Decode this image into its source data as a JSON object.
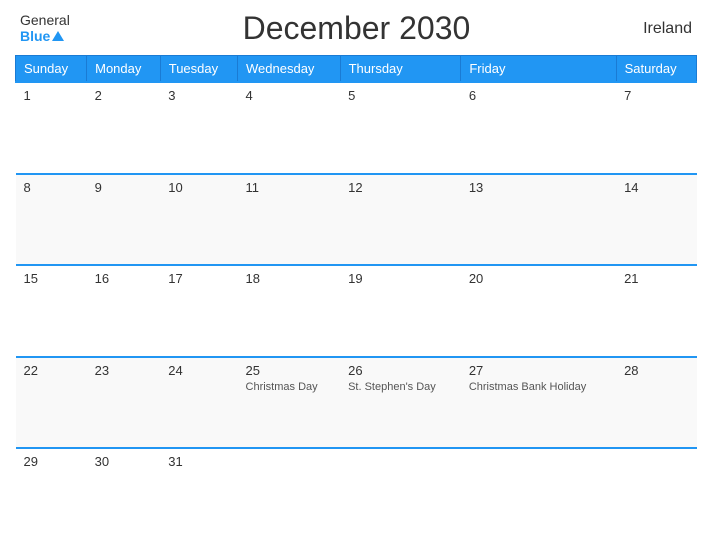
{
  "header": {
    "logo_general": "General",
    "logo_blue": "Blue",
    "title": "December 2030",
    "country": "Ireland"
  },
  "weekdays": [
    "Sunday",
    "Monday",
    "Tuesday",
    "Wednesday",
    "Thursday",
    "Friday",
    "Saturday"
  ],
  "weeks": [
    [
      {
        "day": "1",
        "event": ""
      },
      {
        "day": "2",
        "event": ""
      },
      {
        "day": "3",
        "event": ""
      },
      {
        "day": "4",
        "event": ""
      },
      {
        "day": "5",
        "event": ""
      },
      {
        "day": "6",
        "event": ""
      },
      {
        "day": "7",
        "event": ""
      }
    ],
    [
      {
        "day": "8",
        "event": ""
      },
      {
        "day": "9",
        "event": ""
      },
      {
        "day": "10",
        "event": ""
      },
      {
        "day": "11",
        "event": ""
      },
      {
        "day": "12",
        "event": ""
      },
      {
        "day": "13",
        "event": ""
      },
      {
        "day": "14",
        "event": ""
      }
    ],
    [
      {
        "day": "15",
        "event": ""
      },
      {
        "day": "16",
        "event": ""
      },
      {
        "day": "17",
        "event": ""
      },
      {
        "day": "18",
        "event": ""
      },
      {
        "day": "19",
        "event": ""
      },
      {
        "day": "20",
        "event": ""
      },
      {
        "day": "21",
        "event": ""
      }
    ],
    [
      {
        "day": "22",
        "event": ""
      },
      {
        "day": "23",
        "event": ""
      },
      {
        "day": "24",
        "event": ""
      },
      {
        "day": "25",
        "event": "Christmas Day"
      },
      {
        "day": "26",
        "event": "St. Stephen's Day"
      },
      {
        "day": "27",
        "event": "Christmas Bank Holiday"
      },
      {
        "day": "28",
        "event": ""
      }
    ],
    [
      {
        "day": "29",
        "event": ""
      },
      {
        "day": "30",
        "event": ""
      },
      {
        "day": "31",
        "event": ""
      },
      {
        "day": "",
        "event": ""
      },
      {
        "day": "",
        "event": ""
      },
      {
        "day": "",
        "event": ""
      },
      {
        "day": "",
        "event": ""
      }
    ]
  ]
}
